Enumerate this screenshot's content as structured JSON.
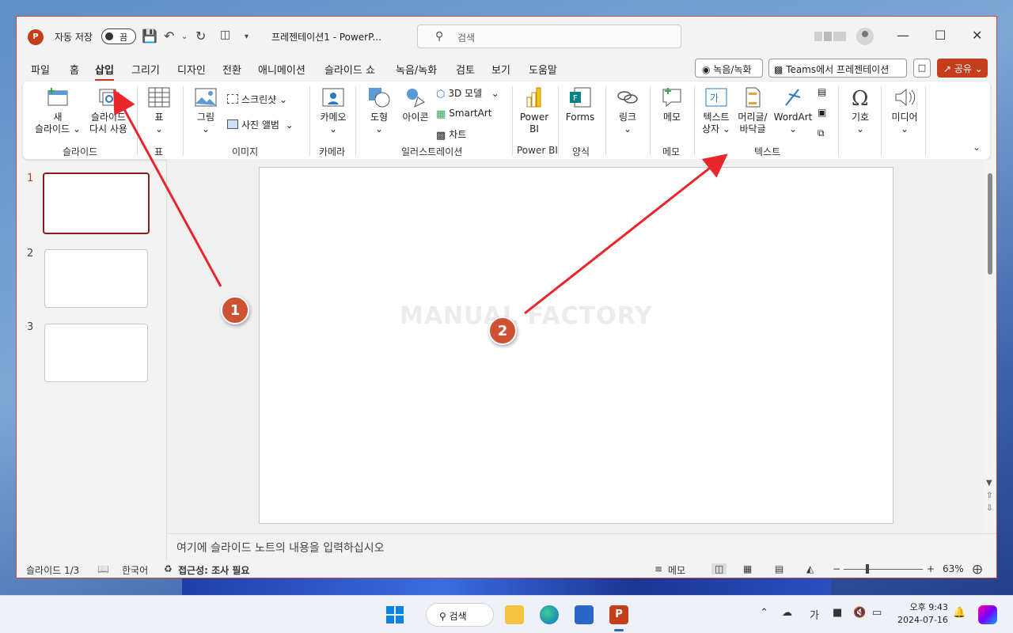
{
  "titlebar": {
    "app_icon": "P",
    "autosave_label": "자동 저장",
    "autosave_state": "끔",
    "doc_title": "프레젠테이션1  -  PowerP...",
    "search_placeholder": "검색"
  },
  "menu_tabs": [
    "파일",
    "홈",
    "삽입",
    "그리기",
    "디자인",
    "전환",
    "애니메이션",
    "슬라이드 쇼",
    "녹음/녹화",
    "검토",
    "보기",
    "도움말"
  ],
  "active_tab": "삽입",
  "header_buttons": {
    "record": "녹음/녹화",
    "teams": "Teams에서 프레젠테이션",
    "share": "공유"
  },
  "ribbon": {
    "slides": {
      "new_slide_1": "새",
      "new_slide_2": "슬라이드",
      "reuse_1": "슬라이드",
      "reuse_2": "다시 사용",
      "label": "슬라이드"
    },
    "table": {
      "btn": "표",
      "label": "표"
    },
    "images": {
      "picture": "그림",
      "screenshot": "스크린샷",
      "album": "사진 앨범",
      "label": "이미지"
    },
    "camera": {
      "btn": "카메오",
      "label": "카메라"
    },
    "illustrations": {
      "shapes": "도형",
      "icons": "아이콘",
      "model3d": "3D 모델",
      "smartart": "SmartArt",
      "chart": "차트",
      "label": "일러스트레이션"
    },
    "powerbi": {
      "btn_1": "Power",
      "btn_2": "BI",
      "label": "Power BI"
    },
    "forms": {
      "btn": "Forms",
      "label": "양식"
    },
    "links": {
      "btn": "링크"
    },
    "comments": {
      "btn": "메모",
      "label": "메모"
    },
    "text": {
      "textbox_1": "텍스트",
      "textbox_2": "상자",
      "header_1": "머리글/",
      "header_2": "바닥글",
      "wordart": "WordArt",
      "label": "텍스트"
    },
    "symbols": {
      "btn": "기호"
    },
    "media": {
      "btn": "미디어"
    }
  },
  "slides_panel": {
    "numbers": [
      "1",
      "2",
      "3"
    ],
    "selected": "1"
  },
  "canvas": {
    "watermark": "MANUAL FACTORY"
  },
  "notes_placeholder": "여기에 슬라이드 노트의 내용을 입력하십시오",
  "statusbar": {
    "slide_count": "슬라이드 1/3",
    "language": "한국어",
    "accessibility": "접근성: 조사 필요",
    "notes_btn": "메모",
    "zoom_minus": "−",
    "zoom_plus": "+",
    "zoom_level": "63%"
  },
  "taskbar": {
    "search": "검색",
    "ime": "가",
    "time": "오후 9:43",
    "date": "2024-07-16"
  },
  "annotations": {
    "marker_1": "1",
    "marker_2": "2"
  },
  "colors": {
    "accent": "#c43e1c",
    "marker": "#cf5134",
    "arrow": "#e8262b"
  }
}
